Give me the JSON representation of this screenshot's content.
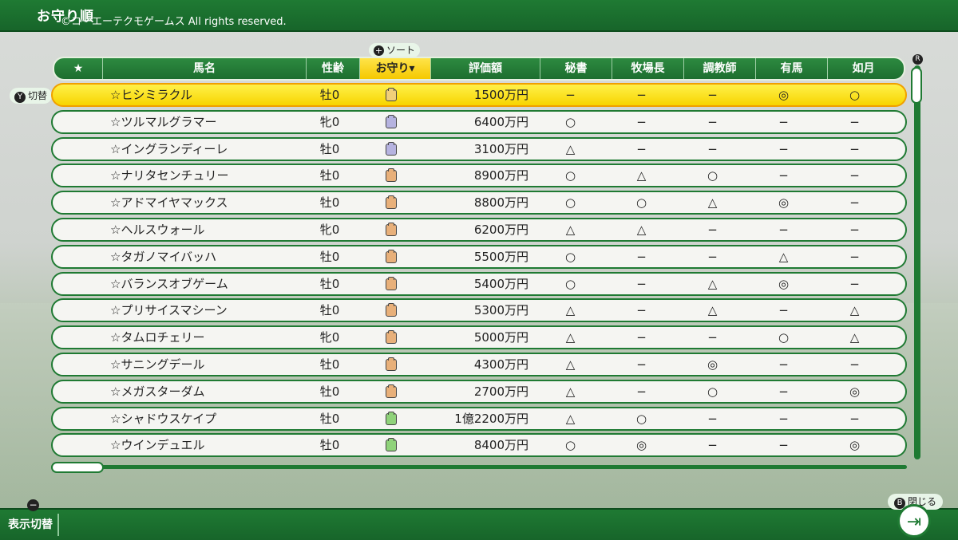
{
  "screen": {
    "title": "お守り順",
    "copyright": "©コーエーテクモゲームス All rights reserved."
  },
  "controls": {
    "sort_button": "+",
    "sort_label": "ソート",
    "swap_button": "Y",
    "swap_label": "切替",
    "display_toggle_button": "−",
    "display_toggle_label": "表示切替",
    "close_button": "B",
    "close_label": "閉じる",
    "scroll_button": "R"
  },
  "table": {
    "columns": [
      "★",
      "馬名",
      "性齢",
      "お守り▾",
      "評価額",
      "秘書",
      "牧場長",
      "調教師",
      "有馬",
      "如月"
    ],
    "selected_column": 3,
    "rows": [
      {
        "name": "☆ヒシミラクル",
        "age": "牡0",
        "charm": "#f0cf7a",
        "value": "1500万円",
        "c1": "−",
        "c2": "−",
        "c3": "−",
        "c4": "◎",
        "c5": "○"
      },
      {
        "name": "☆ツルマルグラマー",
        "age": "牝0",
        "charm": "#b6b3e0",
        "value": "6400万円",
        "c1": "○",
        "c2": "−",
        "c3": "−",
        "c4": "−",
        "c5": "−"
      },
      {
        "name": "☆イングランディーレ",
        "age": "牡0",
        "charm": "#b6b3e0",
        "value": "3100万円",
        "c1": "△",
        "c2": "−",
        "c3": "−",
        "c4": "−",
        "c5": "−"
      },
      {
        "name": "☆ナリタセンチュリー",
        "age": "牡0",
        "charm": "#e8b07a",
        "value": "8900万円",
        "c1": "○",
        "c2": "△",
        "c3": "○",
        "c4": "−",
        "c5": "−"
      },
      {
        "name": "☆アドマイヤマックス",
        "age": "牡0",
        "charm": "#e8b07a",
        "value": "8800万円",
        "c1": "○",
        "c2": "○",
        "c3": "△",
        "c4": "◎",
        "c5": "−"
      },
      {
        "name": "☆ヘルスウォール",
        "age": "牝0",
        "charm": "#e8b07a",
        "value": "6200万円",
        "c1": "△",
        "c2": "△",
        "c3": "−",
        "c4": "−",
        "c5": "−"
      },
      {
        "name": "☆タガノマイバッハ",
        "age": "牡0",
        "charm": "#e8b07a",
        "value": "5500万円",
        "c1": "○",
        "c2": "−",
        "c3": "−",
        "c4": "△",
        "c5": "−"
      },
      {
        "name": "☆バランスオブゲーム",
        "age": "牡0",
        "charm": "#e8b07a",
        "value": "5400万円",
        "c1": "○",
        "c2": "−",
        "c3": "△",
        "c4": "◎",
        "c5": "−"
      },
      {
        "name": "☆プリサイスマシーン",
        "age": "牡0",
        "charm": "#e8b07a",
        "value": "5300万円",
        "c1": "△",
        "c2": "−",
        "c3": "△",
        "c4": "−",
        "c5": "△"
      },
      {
        "name": "☆タムロチェリー",
        "age": "牝0",
        "charm": "#e8b07a",
        "value": "5000万円",
        "c1": "△",
        "c2": "−",
        "c3": "−",
        "c4": "○",
        "c5": "△"
      },
      {
        "name": "☆サニングデール",
        "age": "牡0",
        "charm": "#e8b07a",
        "value": "4300万円",
        "c1": "△",
        "c2": "−",
        "c3": "◎",
        "c4": "−",
        "c5": "−"
      },
      {
        "name": "☆メガスターダム",
        "age": "牡0",
        "charm": "#e8b07a",
        "value": "2700万円",
        "c1": "△",
        "c2": "−",
        "c3": "○",
        "c4": "−",
        "c5": "◎"
      },
      {
        "name": "☆シャドウスケイプ",
        "age": "牡0",
        "charm": "#8fd27a",
        "value": "1億2200万円",
        "c1": "△",
        "c2": "○",
        "c3": "−",
        "c4": "−",
        "c5": "−"
      },
      {
        "name": "☆ウインデュエル",
        "age": "牡0",
        "charm": "#8fd27a",
        "value": "8400万円",
        "c1": "○",
        "c2": "◎",
        "c3": "−",
        "c4": "−",
        "c5": "◎"
      }
    ],
    "selected_row": 0
  }
}
